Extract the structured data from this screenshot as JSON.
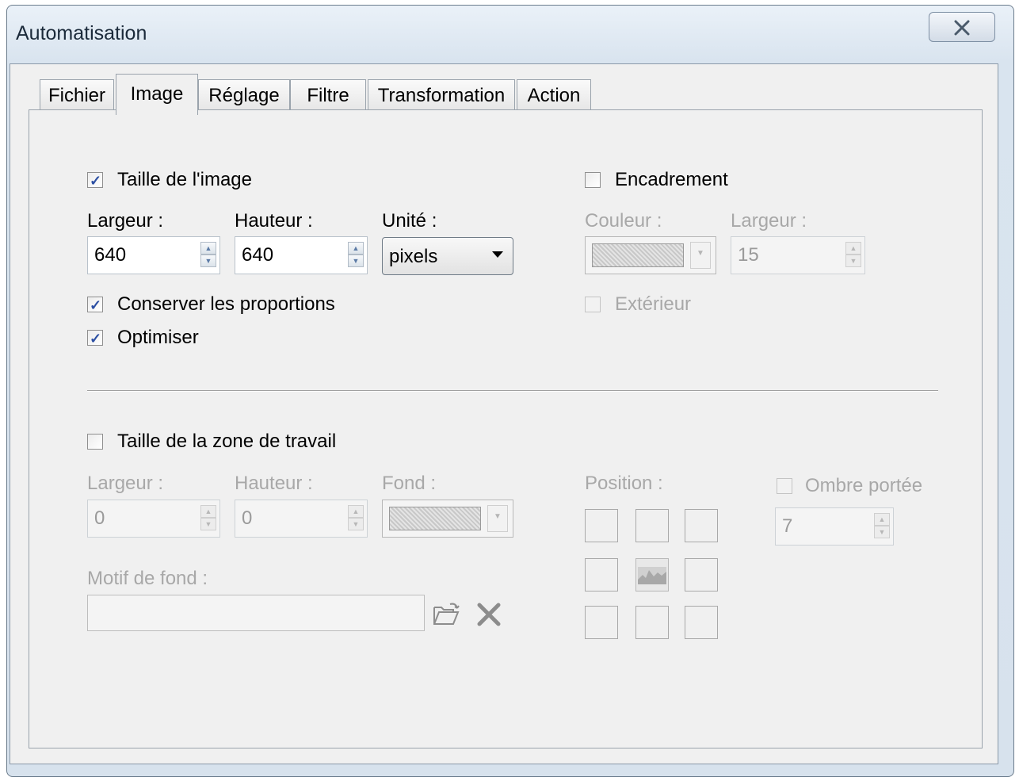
{
  "window": {
    "title": "Automatisation"
  },
  "tabs": [
    "Fichier",
    "Image",
    "Réglage",
    "Filtre",
    "Transformation",
    "Action"
  ],
  "image_size": {
    "label": "Taille de l'image",
    "checked": true,
    "width_label": "Largeur :",
    "width_value": "640",
    "height_label": "Hauteur :",
    "height_value": "640",
    "unit_label": "Unité :",
    "unit_value": "pixels",
    "keep_ratio_label": "Conserver les proportions",
    "keep_ratio_checked": true,
    "optimize_label": "Optimiser",
    "optimize_checked": true
  },
  "frame": {
    "label": "Encadrement",
    "checked": false,
    "color_label": "Couleur :",
    "width_label": "Largeur :",
    "width_value": "15",
    "outside_label": "Extérieur",
    "outside_checked": false
  },
  "canvas": {
    "label": "Taille de la zone de travail",
    "checked": false,
    "width_label": "Largeur :",
    "width_value": "0",
    "height_label": "Hauteur :",
    "height_value": "0",
    "background_label": "Fond :",
    "pattern_label": "Motif de fond :",
    "pattern_value": "",
    "position_label": "Position :",
    "shadow_label": "Ombre portée",
    "shadow_checked": false,
    "shadow_value": "7"
  },
  "icons": {
    "close": "close-icon",
    "open_folder": "open-folder-icon",
    "delete": "delete-x-icon",
    "image": "image-thumbnail-icon"
  }
}
